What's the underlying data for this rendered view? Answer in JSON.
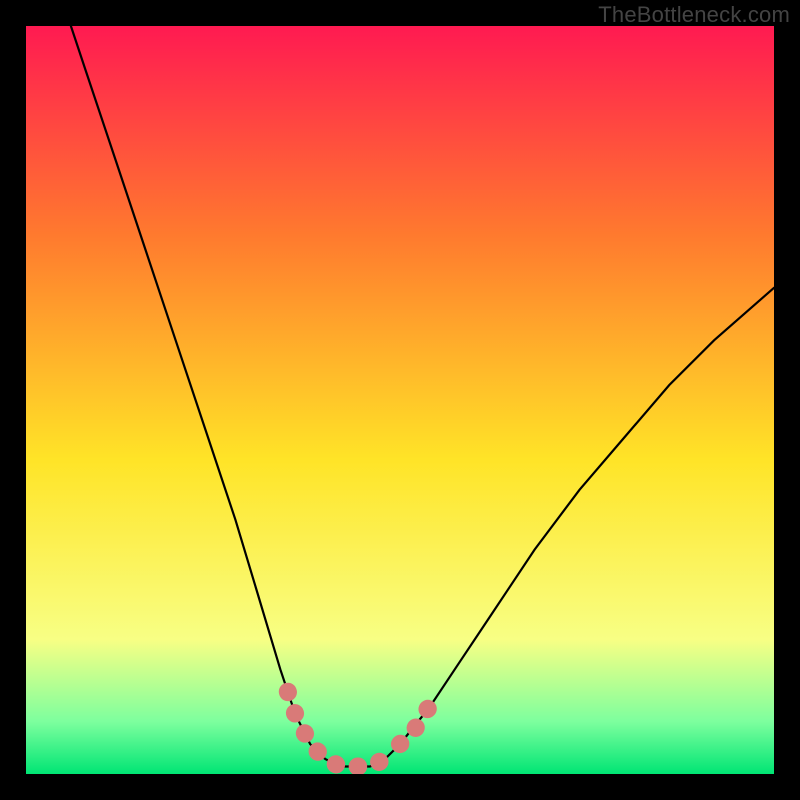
{
  "watermark": "TheBottleneck.com",
  "colors": {
    "frame": "#000000",
    "gradient_top": "#ff1a51",
    "gradient_mid_upper": "#ff7a2e",
    "gradient_mid": "#ffe427",
    "gradient_mid_lower": "#f8ff84",
    "gradient_green_light": "#7dff9e",
    "gradient_bottom": "#00e574",
    "curve": "#000000",
    "marker": "#d97a78"
  },
  "chart_data": {
    "type": "line",
    "title": "",
    "xlabel": "",
    "ylabel": "",
    "xlim": [
      0,
      100
    ],
    "ylim": [
      0,
      100
    ],
    "curve": [
      {
        "x": 6,
        "y": 100
      },
      {
        "x": 8,
        "y": 94
      },
      {
        "x": 12,
        "y": 82
      },
      {
        "x": 16,
        "y": 70
      },
      {
        "x": 20,
        "y": 58
      },
      {
        "x": 24,
        "y": 46
      },
      {
        "x": 28,
        "y": 34
      },
      {
        "x": 31,
        "y": 24
      },
      {
        "x": 34,
        "y": 14
      },
      {
        "x": 36,
        "y": 8
      },
      {
        "x": 38,
        "y": 4
      },
      {
        "x": 40,
        "y": 2
      },
      {
        "x": 42,
        "y": 1
      },
      {
        "x": 44,
        "y": 1
      },
      {
        "x": 46,
        "y": 1
      },
      {
        "x": 48,
        "y": 2
      },
      {
        "x": 50,
        "y": 4
      },
      {
        "x": 54,
        "y": 9
      },
      {
        "x": 58,
        "y": 15
      },
      {
        "x": 62,
        "y": 21
      },
      {
        "x": 68,
        "y": 30
      },
      {
        "x": 74,
        "y": 38
      },
      {
        "x": 80,
        "y": 45
      },
      {
        "x": 86,
        "y": 52
      },
      {
        "x": 92,
        "y": 58
      },
      {
        "x": 100,
        "y": 65
      }
    ],
    "marker_segments": [
      [
        {
          "x": 35,
          "y": 11
        },
        {
          "x": 36,
          "y": 8
        },
        {
          "x": 37,
          "y": 6
        },
        {
          "x": 38,
          "y": 4
        },
        {
          "x": 39,
          "y": 3
        },
        {
          "x": 40,
          "y": 2
        },
        {
          "x": 42,
          "y": 1
        },
        {
          "x": 44,
          "y": 1
        },
        {
          "x": 46,
          "y": 1
        },
        {
          "x": 48,
          "y": 2
        }
      ],
      [
        {
          "x": 50,
          "y": 4
        },
        {
          "x": 51,
          "y": 5
        },
        {
          "x": 52,
          "y": 6
        },
        {
          "x": 53,
          "y": 8
        },
        {
          "x": 54,
          "y": 9
        },
        {
          "x": 55,
          "y": 11
        }
      ]
    ]
  }
}
